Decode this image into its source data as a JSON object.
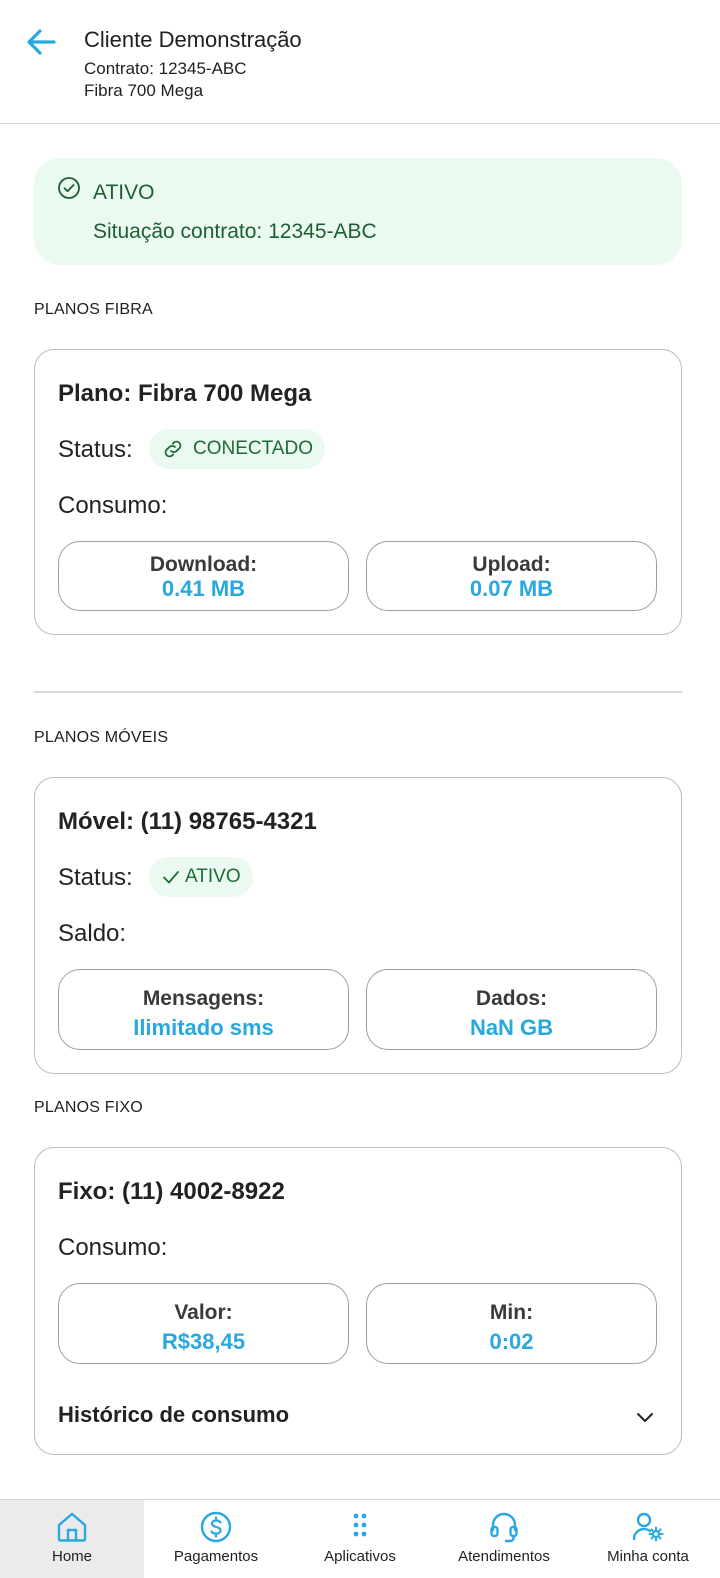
{
  "header": {
    "title": "Cliente Demonstração",
    "contract_line": "Contrato: 12345-ABC",
    "plan_line": "Fibra 700 Mega"
  },
  "status_banner": {
    "title": "ATIVO",
    "description": "Situação contrato: 12345-ABC",
    "icon": "check-circle-icon"
  },
  "fiber": {
    "section_label": "PLANOS FIBRA",
    "title": "Plano: Fibra 700 Mega",
    "status_label": "Status:",
    "status_chip": "CONECTADO",
    "usage_label": "Consumo:",
    "download": {
      "label": "Download:",
      "value": "0.41 MB"
    },
    "upload": {
      "label": "Upload:",
      "value": "0.07 MB"
    }
  },
  "mobile": {
    "section_label": "PLANOS MÓVEIS",
    "title": "Móvel: (11) 98765-4321",
    "status_label": "Status:",
    "status_chip": "ATIVO",
    "balance_label": "Saldo:",
    "messages": {
      "label": "Mensagens:",
      "value": "Ilimitado sms"
    },
    "data": {
      "label": "Dados:",
      "value": "NaN GB"
    }
  },
  "landline": {
    "section_label": "PLANOS FIXO",
    "title": "Fixo: (11) 4002-8922",
    "usage_label": "Consumo:",
    "amount": {
      "label": "Valor:",
      "value": "R$38,45"
    },
    "minutes": {
      "label": "Min:",
      "value": "0:02"
    },
    "history_label": "Histórico de consumo"
  },
  "bottom_nav": {
    "items": [
      {
        "label": "Home",
        "icon": "home-icon",
        "active": true
      },
      {
        "label": "Pagamentos",
        "icon": "dollar-circle-icon",
        "active": false
      },
      {
        "label": "Aplicativos",
        "icon": "apps-grid-icon",
        "active": false
      },
      {
        "label": "Atendimentos",
        "icon": "headset-icon",
        "active": false
      },
      {
        "label": "Minha conta",
        "icon": "user-settings-icon",
        "active": false
      }
    ]
  },
  "colors": {
    "accent": "#29a8e0",
    "success_bg": "#eafaf0",
    "success_text": "#1e5e32"
  }
}
